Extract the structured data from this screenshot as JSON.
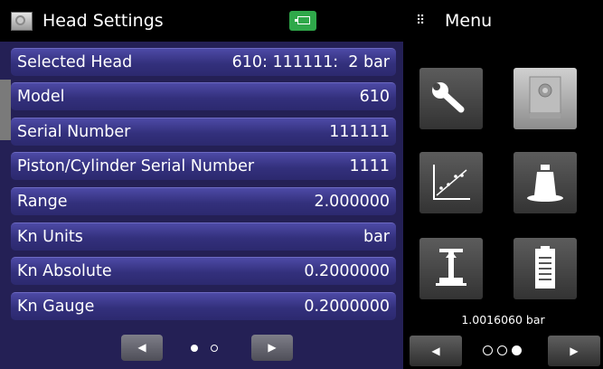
{
  "header": {
    "title": "Head Settings",
    "title_icon": "pressure-head-icon",
    "status_icon": "battery-icon",
    "status_color": "#2fa84a"
  },
  "settings": [
    {
      "label": "Selected Head",
      "value": "610: 111111:  2 bar"
    },
    {
      "label": "Model",
      "value": "610"
    },
    {
      "label": "Serial Number",
      "value": "111111"
    },
    {
      "label": "Piston/Cylinder Serial Number",
      "value": "1111"
    },
    {
      "label": "Range",
      "value": "2.000000"
    },
    {
      "label": "Kn Units",
      "value": "bar"
    },
    {
      "label": "Kn Absolute",
      "value": "0.2000000"
    },
    {
      "label": "Kn Gauge",
      "value": "0.2000000"
    }
  ],
  "left_nav": {
    "prev": "◀",
    "next": "▶",
    "page": 1,
    "page_count": 2
  },
  "menu": {
    "icon": "⠿",
    "title": "Menu",
    "tiles": [
      {
        "icon": "wrench-icon",
        "active": false
      },
      {
        "icon": "pressure-head-icon",
        "active": true
      },
      {
        "icon": "chart-icon",
        "active": false
      },
      {
        "icon": "weight-icon",
        "active": false
      },
      {
        "icon": "piston-icon",
        "active": false
      },
      {
        "icon": "document-icon",
        "active": false
      }
    ],
    "pressure_reading": "1.0016060 bar",
    "nav": {
      "prev": "◀",
      "next": "▶",
      "page": 3,
      "page_count": 3
    }
  },
  "colors": {
    "panel": "#242055",
    "row": "#3e3a94",
    "header_bg": "#000000"
  }
}
